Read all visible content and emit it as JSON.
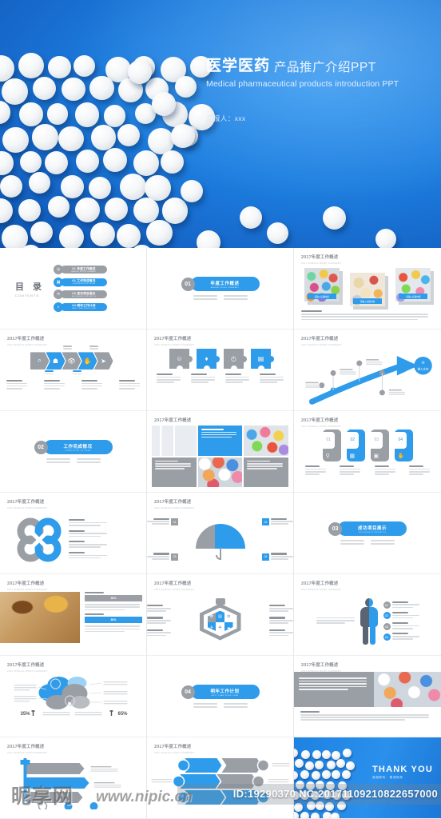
{
  "hero": {
    "title_cn": "医学医药",
    "title_cn2": "产品推广介绍PPT",
    "title_en": "Medical pharmaceutical products introduction PPT",
    "presenter": "汇报人：xxx",
    "bg_color": "#1d7fe0"
  },
  "common": {
    "slide_title": "2017年度工作概述",
    "slide_subtitle": "2017 ANNUAL WORK SUMMARY",
    "placeholder_heading": "请输入标题内容",
    "accent_blue": "#2f9ceb",
    "accent_gray": "#9a9ea5"
  },
  "contents": {
    "title_cn": "目 录",
    "title_en": "CONTENTS",
    "items": [
      {
        "no": "01",
        "label": "年度工作概述",
        "en": "ANNUAL WORK SUMMARY",
        "color": "#9a9ea5",
        "icon": "target-icon"
      },
      {
        "no": "02",
        "label": "工作完成情况",
        "en": "COMPLETION OF WORK",
        "color": "#2f9ceb",
        "icon": "chart-icon"
      },
      {
        "no": "03",
        "label": "成功项目展示",
        "en": "SUCCESSFUL PROJECTS",
        "color": "#9a9ea5",
        "icon": "trophy-icon"
      },
      {
        "no": "04",
        "label": "明年工作计划",
        "en": "NEXT YEAR WORK PLAN",
        "color": "#2f9ceb",
        "icon": "search-icon"
      }
    ]
  },
  "sections": [
    {
      "no": "01",
      "label": "年度工作概述",
      "en": "ANNUAL WORK SUMMARY"
    },
    {
      "no": "02",
      "label": "工作完成情况",
      "en": "COMPLETION OF WORK"
    },
    {
      "no": "03",
      "label": "成功项目展示",
      "en": "SUCCESSFUL PROJECTS"
    },
    {
      "no": "04",
      "label": "明年工作计划",
      "en": "NEXT YEAR WORK PLAN"
    }
  ],
  "photo_slide": {
    "caption": "请输入标题内容",
    "body_heading": "请输入标题内容"
  },
  "chevron_slide": {
    "icons": [
      "search-icon",
      "people-icon",
      "eye-icon",
      "thumbsup-icon",
      "send-icon"
    ],
    "colors": [
      "#9a9ea5",
      "#2f9ceb",
      "#9a9ea5",
      "#2f9ceb",
      "#9a9ea5"
    ]
  },
  "puzzle_slide": {
    "icons": [
      "smiley-icon",
      "bulb-icon",
      "clock-icon",
      "monitor-icon"
    ],
    "colors": [
      "#9a9ea5",
      "#2f9ceb",
      "#9a9ea5",
      "#2f9ceb"
    ]
  },
  "arrow_slide": {
    "badge_label": "输入文本",
    "badge_icon": "trophy-icon",
    "milestones": 5
  },
  "cards_slide": {
    "numbers": [
      "01",
      "02",
      "03",
      "04"
    ],
    "icons": [
      "pill-icon",
      "chart-icon",
      "camera-icon",
      "like-icon"
    ],
    "colors": [
      "#9a9ea5",
      "#2f9ceb",
      "#9a9ea5",
      "#2f9ceb"
    ]
  },
  "umbrella_slide": {
    "callouts": [
      "01",
      "02",
      "03",
      "04"
    ]
  },
  "progress_slide": {
    "bars": [
      {
        "label": "30%",
        "value": 30,
        "color": "#9a9ea5"
      },
      {
        "label": "80%",
        "value": 80,
        "color": "#2f9ceb"
      }
    ]
  },
  "hexagon_slide": {
    "icons": [
      "flask-icon",
      "book-icon",
      "rocket-icon",
      "leaf-icon",
      "car-icon",
      "gear-icon"
    ]
  },
  "body_slide": {
    "callouts": [
      "01",
      "02",
      "03",
      "04"
    ]
  },
  "brain_slide": {
    "left_percent": "35%",
    "right_percent": "65%"
  },
  "thank_you": {
    "title": "THANK YOU",
    "subtitle": "感谢聆听 · 敬请指导"
  },
  "watermark": {
    "logo": "昵享网",
    "url": "www.nipic.cn",
    "id": "ID:19290370 NC:20171109210822657000"
  }
}
